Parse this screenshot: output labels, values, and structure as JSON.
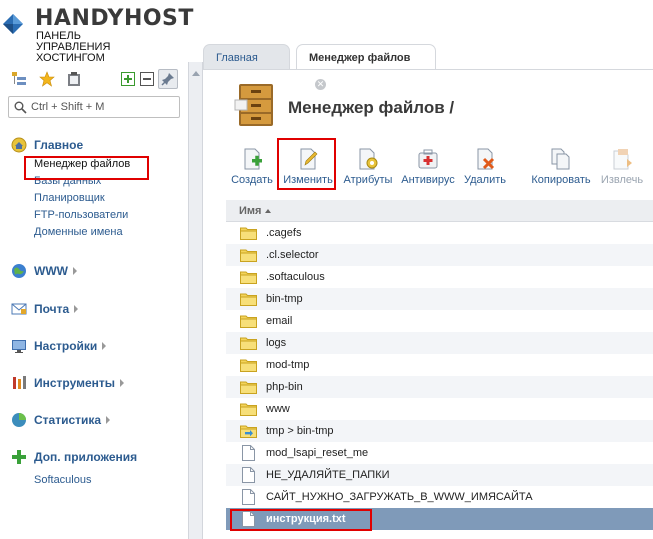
{
  "logo": {
    "brand": "HANDYHOST",
    "subtitle_lines": [
      "ПАНЕЛЬ",
      "УПРАВЛЕНИЯ",
      "ХОСТИНГОМ"
    ]
  },
  "search": {
    "placeholder": "Ctrl + Shift + M"
  },
  "sidebar": {
    "sections": [
      {
        "title": "Главное",
        "icon": "home-icon",
        "expanded": true,
        "items": [
          "Менеджер файлов",
          "Базы данных",
          "Планировщик",
          "FTP-пользователи",
          "Доменные имена"
        ]
      },
      {
        "title": "WWW",
        "icon": "globe-icon",
        "expanded": false
      },
      {
        "title": "Почта",
        "icon": "mail-icon",
        "expanded": false
      },
      {
        "title": "Настройки",
        "icon": "settings-icon",
        "expanded": false
      },
      {
        "title": "Инструменты",
        "icon": "tools-icon",
        "expanded": false
      },
      {
        "title": "Статистика",
        "icon": "stats-icon",
        "expanded": false
      },
      {
        "title": "Доп. приложения",
        "icon": "plus-icon",
        "expanded": true,
        "items": [
          "Softaculous"
        ]
      }
    ]
  },
  "tabs": [
    {
      "label": "Главная",
      "active": false
    },
    {
      "label": "Менеджер файлов",
      "active": true
    }
  ],
  "page_title": "Менеджер файлов /",
  "toolbar": {
    "create": "Создать",
    "edit": "Изменить",
    "attributes": "Атрибуты",
    "antivirus": "Антивирус",
    "delete": "Удалить",
    "copy": "Копировать",
    "extract": "Извлечь"
  },
  "table": {
    "header": "Имя",
    "rows": [
      {
        "name": ".cagefs",
        "type": "folder"
      },
      {
        "name": ".cl.selector",
        "type": "folder"
      },
      {
        "name": ".softaculous",
        "type": "folder"
      },
      {
        "name": "bin-tmp",
        "type": "folder"
      },
      {
        "name": "email",
        "type": "folder"
      },
      {
        "name": "logs",
        "type": "folder"
      },
      {
        "name": "mod-tmp",
        "type": "folder"
      },
      {
        "name": "php-bin",
        "type": "folder"
      },
      {
        "name": "www",
        "type": "folder"
      },
      {
        "name": "tmp > bin-tmp",
        "type": "link"
      },
      {
        "name": "mod_lsapi_reset_me",
        "type": "file"
      },
      {
        "name": "НЕ_УДАЛЯЙТЕ_ПАПКИ",
        "type": "file"
      },
      {
        "name": "САЙТ_НУЖНО_ЗАГРУЖАТЬ_В_WWW_ИМЯСАЙТА",
        "type": "file"
      },
      {
        "name": "инструкция.txt",
        "type": "file",
        "selected": true
      }
    ]
  },
  "colors": {
    "link": "#2c5b8f",
    "selected_row": "#7f9ab9",
    "highlight": "#e00000"
  }
}
